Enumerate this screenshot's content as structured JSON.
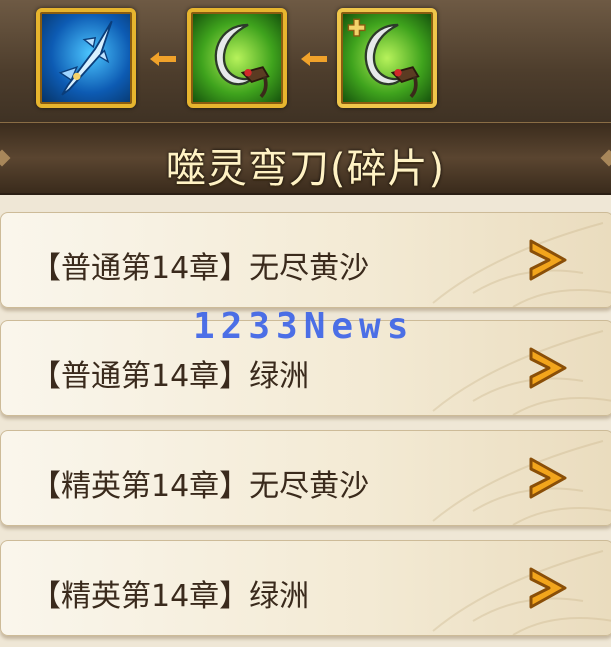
{
  "equipment_chain": {
    "items": [
      {
        "icon": "spear-icon",
        "rarity_color": "#1a7fe0"
      },
      {
        "icon": "curved-blade-icon",
        "rarity_color": "#4bb52a"
      },
      {
        "icon": "curved-blade-fragment-icon",
        "rarity_color": "#4bb52a",
        "selected": true
      }
    ],
    "arrow_color": "#f0a22a"
  },
  "title": "噬灵弯刀(碎片)",
  "sources": [
    {
      "label": "【普通第14章】无尽黄沙"
    },
    {
      "label": "【普通第14章】绿洲"
    },
    {
      "label": "【精英第14章】无尽黄沙"
    },
    {
      "label": "【精英第14章】绿洲"
    }
  ],
  "watermark": "1233News",
  "colors": {
    "frame_gold": "#e7b52e",
    "title_text": "#fff2c4",
    "row_text": "#3a2a1c",
    "go_arrow": "#f2a51c"
  }
}
